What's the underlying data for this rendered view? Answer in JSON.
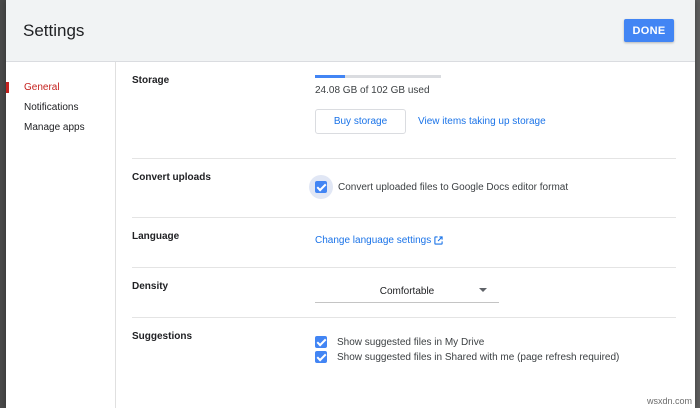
{
  "dialog": {
    "title": "Settings",
    "done_label": "DONE"
  },
  "sidebar": {
    "items": [
      {
        "label": "General",
        "active": true
      },
      {
        "label": "Notifications",
        "active": false
      },
      {
        "label": "Manage apps",
        "active": false
      }
    ]
  },
  "storage": {
    "label": "Storage",
    "used_text": "24.08 GB of 102 GB used",
    "used_fraction": 0.236,
    "buy_label": "Buy storage",
    "view_label": "View items taking up storage"
  },
  "convert": {
    "label": "Convert uploads",
    "checkbox_label": "Convert uploaded files to Google Docs editor format",
    "checked": true
  },
  "language": {
    "label": "Language",
    "link_label": "Change language settings",
    "link_icon": "external-link-icon"
  },
  "density": {
    "label": "Density",
    "value": "Comfortable"
  },
  "suggestions": {
    "label": "Suggestions",
    "options": [
      {
        "label": "Show suggested files in My Drive",
        "checked": true
      },
      {
        "label": "Show suggested files in Shared with me (page refresh required)",
        "checked": true
      }
    ]
  },
  "watermark": "wsxdn.com",
  "colors": {
    "accent": "#4285f4",
    "active_nav": "#c5221f",
    "link": "#1a73e8"
  }
}
